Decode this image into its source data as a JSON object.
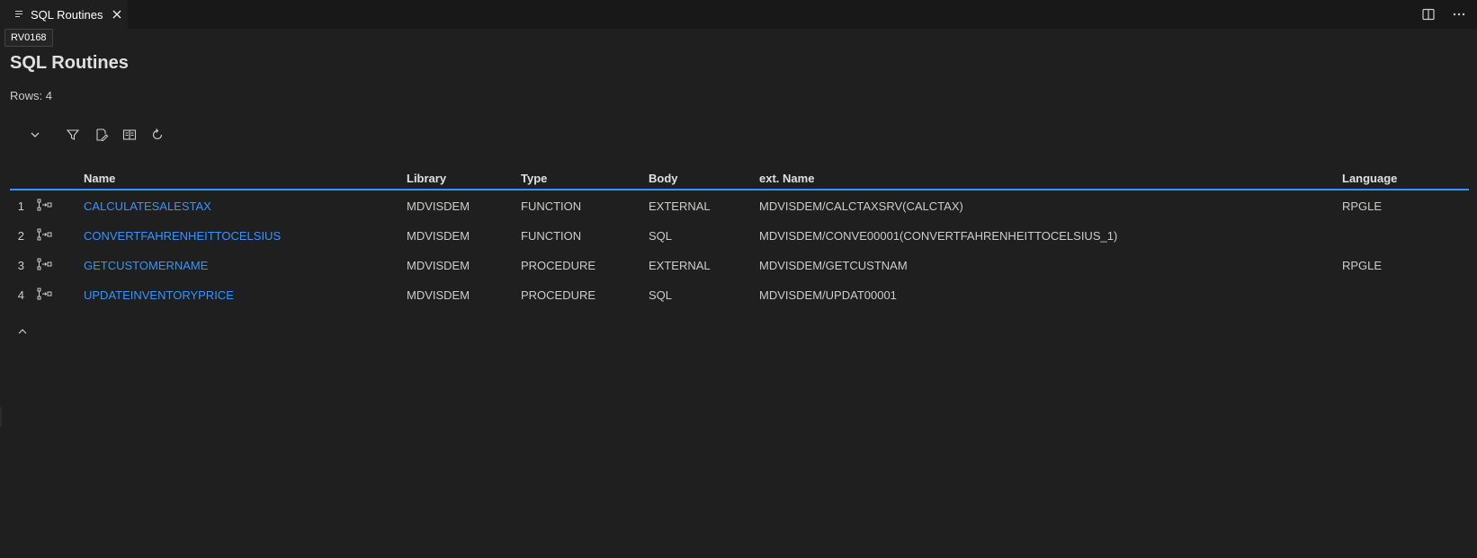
{
  "tab": {
    "title": "SQL Routines",
    "icon": "list-icon",
    "close_icon": "close-icon"
  },
  "tabbar_actions": [
    "split-editor-icon",
    "more-actions-icon"
  ],
  "badge": "RV0168",
  "page": {
    "title": "SQL Routines",
    "row_count": "Rows: 4"
  },
  "toolbar": {
    "buttons": [
      "collapse-icon",
      "filter-icon",
      "edit-icon",
      "columns-icon",
      "refresh-icon"
    ]
  },
  "table": {
    "headers": {
      "name": "Name",
      "library": "Library",
      "type": "Type",
      "body": "Body",
      "ext_name": "ext. Name",
      "language": "Language"
    },
    "rows": [
      {
        "num": "1",
        "name": "CALCULATESALESTAX",
        "library": "MDVISDEM",
        "type": "FUNCTION",
        "body": "EXTERNAL",
        "ext_name": "MDVISDEM/CALCTAXSRV(CALCTAX)",
        "language": "RPGLE"
      },
      {
        "num": "2",
        "name": "CONVERTFAHRENHEITTOCELSIUS",
        "library": "MDVISDEM",
        "type": "FUNCTION",
        "body": "SQL",
        "ext_name": "MDVISDEM/CONVE00001(CONVERTFAHRENHEITTOCELSIUS_1)",
        "language": ""
      },
      {
        "num": "3",
        "name": "GETCUSTOMERNAME",
        "library": "MDVISDEM",
        "type": "PROCEDURE",
        "body": "EXTERNAL",
        "ext_name": "MDVISDEM/GETCUSTNAM",
        "language": "RPGLE"
      },
      {
        "num": "4",
        "name": "UPDATEINVENTORYPRICE",
        "library": "MDVISDEM",
        "type": "PROCEDURE",
        "body": "SQL",
        "ext_name": "MDVISDEM/UPDAT00001",
        "language": ""
      }
    ]
  },
  "colors": {
    "background": "#1f1f1f",
    "link": "#3794ff",
    "header_rule": "#3794ff"
  }
}
